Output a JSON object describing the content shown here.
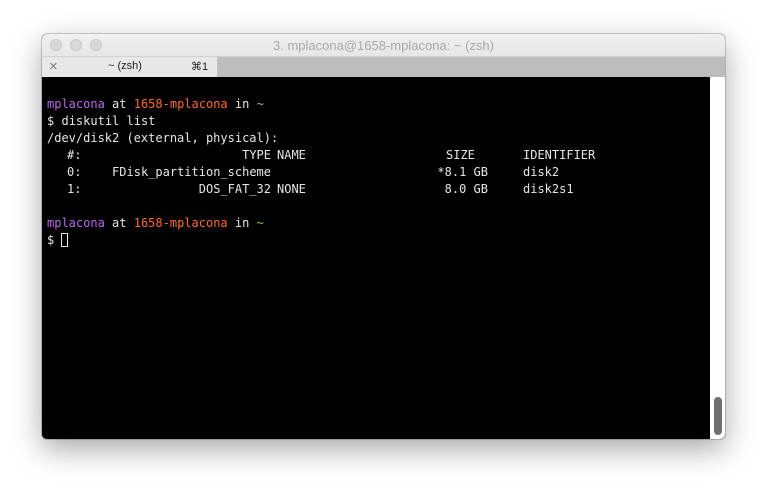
{
  "window": {
    "title": "3. mplacona@1658-mplacona: ~ (zsh)"
  },
  "tab": {
    "close": "×",
    "label": "~ (zsh)",
    "shortcut": "⌘1"
  },
  "prompt": {
    "user": "mplacona",
    "at": "at",
    "host": "1658-mplacona",
    "in": "in",
    "dir": "~",
    "symbol": "$"
  },
  "command": "diskutil list",
  "disk_header": "/dev/disk2 (external, physical):",
  "table": {
    "columns": {
      "num": "#:",
      "type": "TYPE",
      "name": "NAME",
      "size": "SIZE",
      "identifier": "IDENTIFIER"
    },
    "rows": [
      {
        "num": "0:",
        "type": "FDisk_partition_scheme",
        "name": "",
        "size": "*8.1 GB",
        "identifier": "disk2"
      },
      {
        "num": "1:",
        "type": "DOS_FAT_32",
        "name": "NONE",
        "size": "8.0 GB",
        "identifier": "disk2s1"
      }
    ]
  },
  "colors": {
    "user": "#b967e6",
    "host": "#ff6a2a",
    "dir": "#8fc94a",
    "background": "#000000",
    "text": "#e6e6e6"
  }
}
